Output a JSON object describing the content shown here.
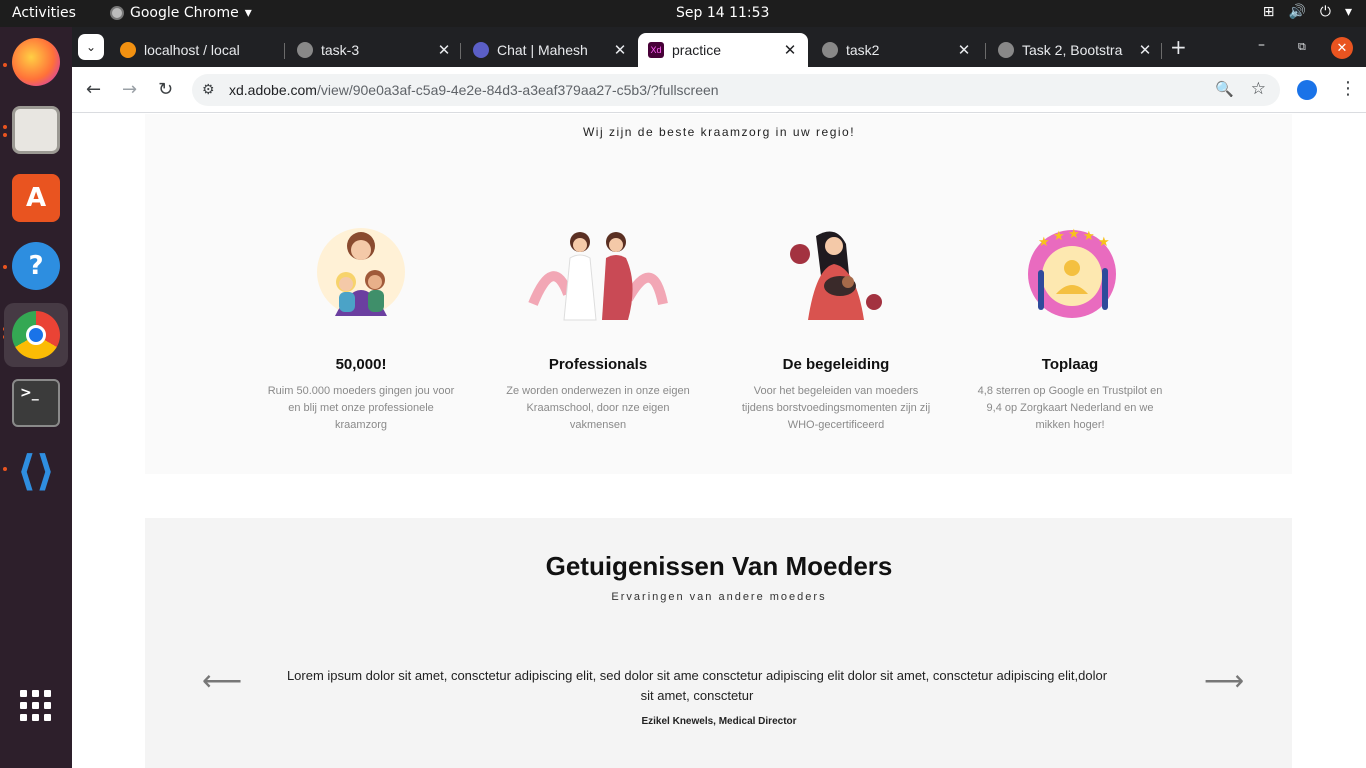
{
  "topbar": {
    "activities": "Activities",
    "app_name": "Google Chrome",
    "datetime": "Sep 14  11:53"
  },
  "dock": {
    "items": [
      "firefox-icon",
      "files-icon",
      "app-center-icon",
      "help-icon",
      "chrome-icon",
      "terminal-icon",
      "vscode-icon"
    ]
  },
  "browser": {
    "tabs": [
      {
        "title": "localhost / local"
      },
      {
        "title": "task-3"
      },
      {
        "title": "Chat | Mahesh"
      },
      {
        "title": "practice"
      },
      {
        "title": "task2"
      },
      {
        "title": "Task 2, Bootstra"
      }
    ],
    "url_host": "xd.adobe.com",
    "url_path": "/view/90e0a3af-c5a9-4e2e-84d3-a3eaf379aa27-c5b3/?fullscreen"
  },
  "page": {
    "subtitle": "Wij zijn de beste kraamzorg in uw regio!",
    "features": [
      {
        "title": "50,000!",
        "text": "Ruim 50.000 moeders gingen jou voor en blij met onze professionele kraamzorg"
      },
      {
        "title": "Professionals",
        "text": "Ze worden onderwezen in onze eigen Kraamschool, door nze eigen vakmensen"
      },
      {
        "title": "De begeleiding",
        "text": "Voor het begeleiden van moeders tijdens borstvoedingsmomenten zijn zij WHO-gecertificeerd"
      },
      {
        "title": "Toplaag",
        "text": "4,8 sterren op Google en Trustpilot en 9,4 op Zorgkaart Nederland en we mikken hoger!"
      }
    ],
    "testimonials": {
      "title": "Getuigenissen Van Moeders",
      "subtitle": "Ervaringen van andere moeders",
      "quote": "Lorem ipsum dolor sit amet, consctetur adipiscing elit, sed dolor sit ame  consctetur adipiscing elit dolor sit amet, consctetur adipiscing elit,dolor sit amet, consctetur",
      "author": "Ezikel Knewels, Medical Director"
    }
  }
}
